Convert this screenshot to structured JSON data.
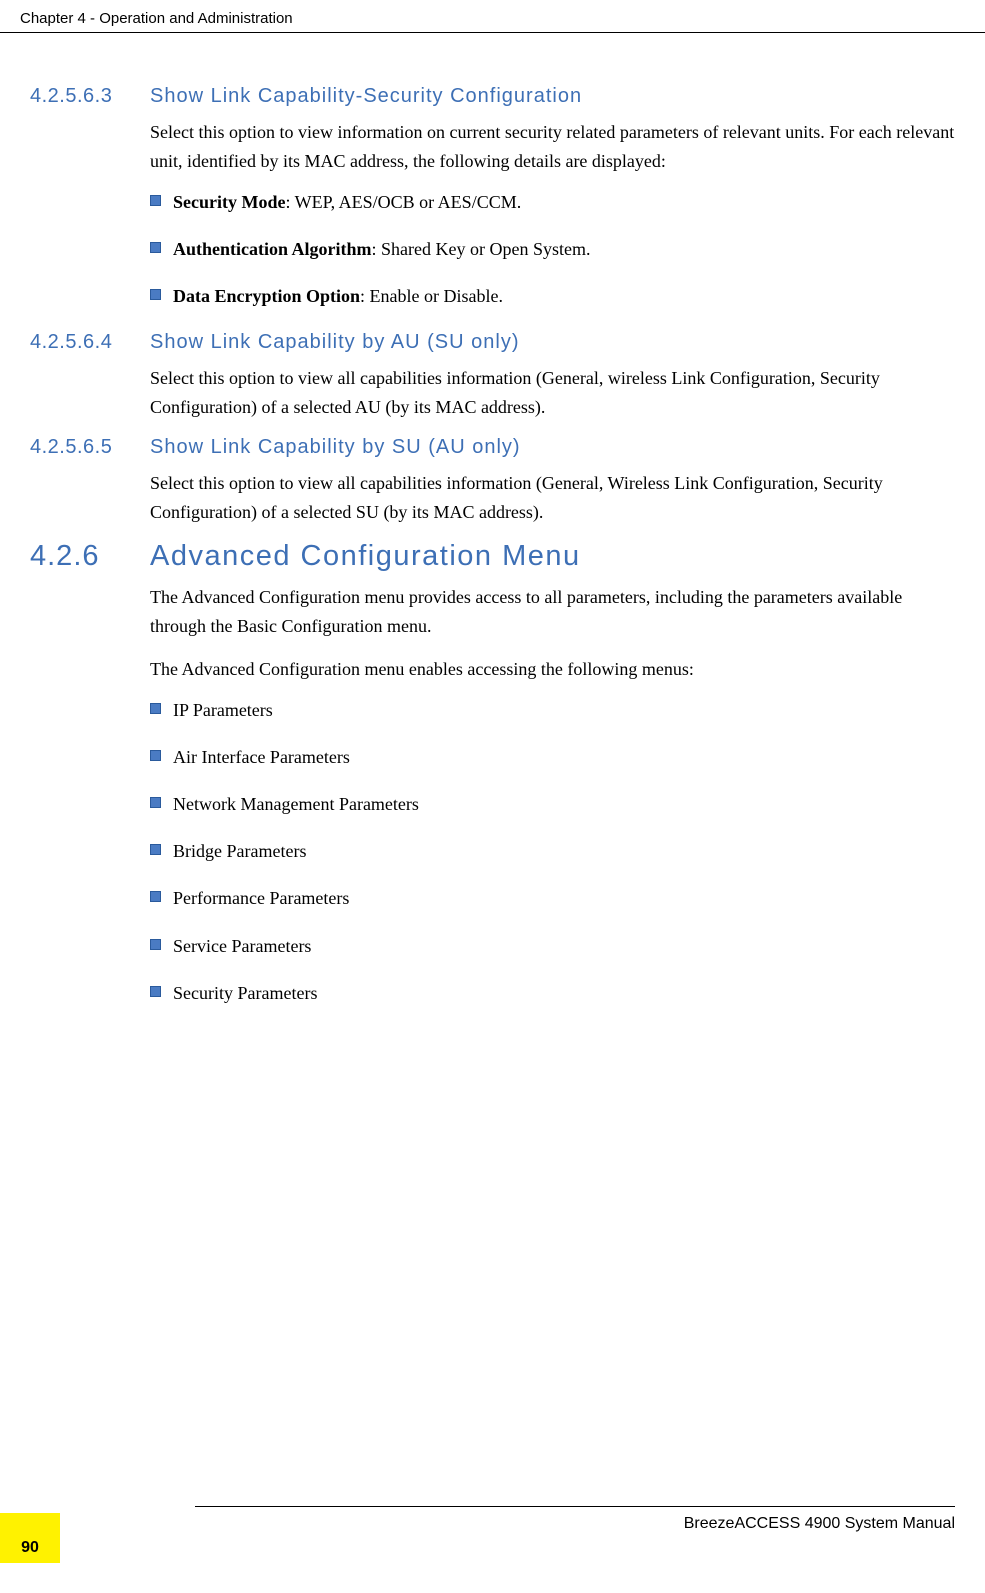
{
  "header": {
    "chapter": "Chapter 4 - Operation and Administration"
  },
  "sections": {
    "s1": {
      "number": "4.2.5.6.3",
      "title": "Show Link Capability-Security Configuration",
      "body": "Select this option to view information on current security related parameters of relevant units. For each relevant unit, identified by its MAC address, the following details are displayed:",
      "bullets": {
        "b1_bold": "Security Mode",
        "b1_rest": ": WEP, AES/OCB or AES/CCM.",
        "b2_bold": "Authentication Algorithm",
        "b2_rest": ": Shared Key or Open System.",
        "b3_bold": "Data Encryption Option",
        "b3_rest": ": Enable or Disable."
      }
    },
    "s2": {
      "number": "4.2.5.6.4",
      "title": "Show Link Capability by AU (SU only)",
      "body": "Select this option to view all capabilities information (General, wireless Link Configuration, Security Configuration) of a selected AU (by its MAC address)."
    },
    "s3": {
      "number": "4.2.5.6.5",
      "title": "Show Link Capability by SU (AU only)",
      "body": "Select this option to view all capabilities information (General, Wireless Link Configuration, Security Configuration) of a selected SU (by its MAC address)."
    },
    "s4": {
      "number": "4.2.6",
      "title": "Advanced Configuration Menu",
      "body1": "The Advanced Configuration menu provides access to all parameters, including the parameters available through the Basic Configuration menu.",
      "body2": "The Advanced Configuration menu enables accessing the following menus:",
      "bullets": {
        "b1": "IP Parameters",
        "b2": "Air Interface Parameters",
        "b3": "Network Management Parameters",
        "b4": "Bridge Parameters",
        "b5": "Performance Parameters",
        "b6": "Service Parameters",
        "b7": "Security Parameters"
      }
    }
  },
  "footer": {
    "page": "90",
    "product": "BreezeACCESS 4900 System Manual"
  }
}
